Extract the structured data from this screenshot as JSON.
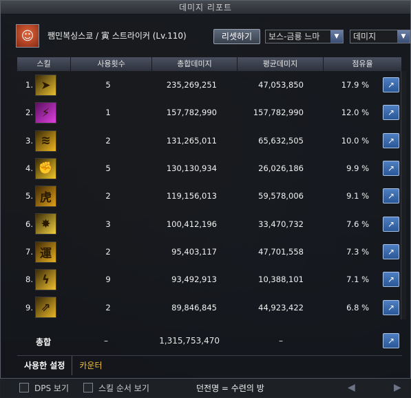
{
  "window": {
    "title": "데미지 리포트"
  },
  "header": {
    "character_icon": "character-portrait",
    "character_name": "쨈민복싱스쿄 / 寅 스트라이커 (Lv.110)",
    "reset_label": "리셋하기",
    "boss_select": "보스-금룡 느마",
    "damage_select": "데미지"
  },
  "columns": [
    "스킬",
    "사용횟수",
    "총합데미지",
    "평균데미지",
    "점유율"
  ],
  "rows": [
    {
      "index": "1.",
      "icon": "strike-arrow-icon",
      "count": "5",
      "total": "235,269,251",
      "avg": "47,053,850",
      "pct": "17.9",
      "unit": "%"
    },
    {
      "index": "2.",
      "icon": "lightning-claw-icon",
      "count": "1",
      "total": "157,782,990",
      "avg": "157,782,990",
      "pct": "12.0",
      "unit": "%"
    },
    {
      "index": "3.",
      "icon": "triple-slash-icon",
      "count": "2",
      "total": "131,265,011",
      "avg": "65,632,505",
      "pct": "10.0",
      "unit": "%"
    },
    {
      "index": "4.",
      "icon": "fist-burst-icon",
      "count": "5",
      "total": "130,130,934",
      "avg": "26,026,186",
      "pct": "9.9",
      "unit": "%"
    },
    {
      "index": "5.",
      "icon": "tiger-glyph-icon",
      "count": "2",
      "total": "119,156,013",
      "avg": "59,578,006",
      "pct": "9.1",
      "unit": "%"
    },
    {
      "index": "6.",
      "icon": "spark-burst-icon",
      "count": "3",
      "total": "100,412,196",
      "avg": "33,470,732",
      "pct": "7.6",
      "unit": "%"
    },
    {
      "index": "7.",
      "icon": "fortune-glyph-icon",
      "count": "2",
      "total": "95,403,117",
      "avg": "47,701,558",
      "pct": "7.3",
      "unit": "%"
    },
    {
      "index": "8.",
      "icon": "zigzag-bolt-icon",
      "count": "9",
      "total": "93,492,913",
      "avg": "10,388,101",
      "pct": "7.1",
      "unit": "%"
    },
    {
      "index": "9.",
      "icon": "dash-strike-icon",
      "count": "2",
      "total": "89,846,845",
      "avg": "44,923,422",
      "pct": "6.8",
      "unit": "%"
    }
  ],
  "total_row": {
    "label": "총합",
    "count": "–",
    "total": "1,315,753,470",
    "avg": "–"
  },
  "tabs": {
    "used": "사용한 설정",
    "counter": "카운터"
  },
  "bottom": {
    "dps_label": "DPS 보기",
    "skill_order_label": "스킬 순서 보기",
    "dungeon": "던전명 = 수련의 방"
  },
  "colors": {
    "accent_blue": "#2a5796",
    "tab_gold": "#f0c040"
  }
}
